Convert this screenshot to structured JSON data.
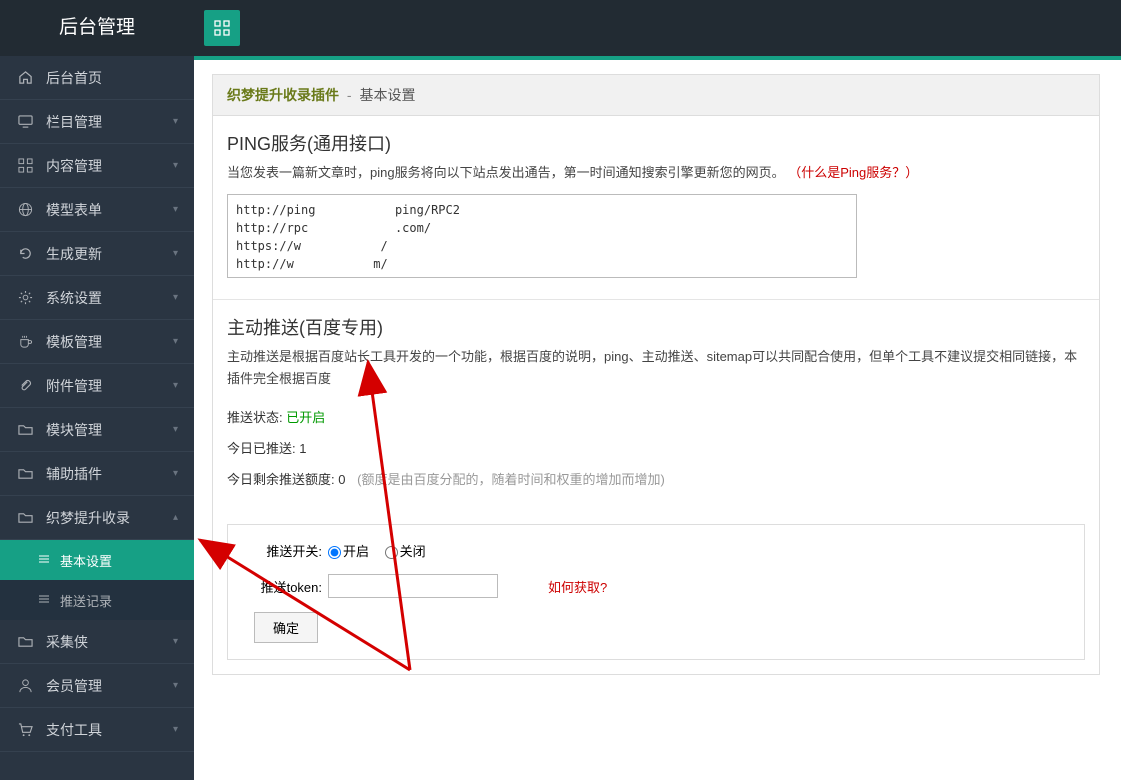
{
  "header": {
    "title": "后台管理"
  },
  "sidebar": {
    "items": [
      {
        "icon": "home",
        "label": "后台首页",
        "chev": ""
      },
      {
        "icon": "monitor",
        "label": "栏目管理",
        "chev": "▾"
      },
      {
        "icon": "grid",
        "label": "内容管理",
        "chev": "▾"
      },
      {
        "icon": "globe",
        "label": "模型表单",
        "chev": "▾"
      },
      {
        "icon": "refresh",
        "label": "生成更新",
        "chev": "▾"
      },
      {
        "icon": "gear",
        "label": "系统设置",
        "chev": "▾"
      },
      {
        "icon": "cup",
        "label": "模板管理",
        "chev": "▾"
      },
      {
        "icon": "clip",
        "label": "附件管理",
        "chev": "▾"
      },
      {
        "icon": "folder",
        "label": "模块管理",
        "chev": "▾"
      },
      {
        "icon": "folder",
        "label": "辅助插件",
        "chev": "▾"
      },
      {
        "icon": "folder",
        "label": "织梦提升收录",
        "chev": "▴",
        "expanded": true,
        "children": [
          {
            "label": "基本设置",
            "active": true
          },
          {
            "label": "推送记录",
            "active": false
          }
        ]
      },
      {
        "icon": "folder",
        "label": "采集侠",
        "chev": "▾"
      },
      {
        "icon": "user",
        "label": "会员管理",
        "chev": "▾"
      },
      {
        "icon": "cart",
        "label": "支付工具",
        "chev": "▾"
      }
    ]
  },
  "panel": {
    "plugin": "织梦提升收录插件",
    "sep": "-",
    "subtitle": "基本设置"
  },
  "ping": {
    "title": "PING服务(通用接口)",
    "desc": "当您发表一篇新文章时，ping服务将向以下站点发出通告，第一时间通知搜索引擎更新您的网页。",
    "link": "（什么是Ping服务？）",
    "urls": "http://ping           ping/RPC2\nhttp://rpc            .com/\nhttps://w           /\nhttp://w           m/"
  },
  "push": {
    "title": "主动推送(百度专用)",
    "desc": "主动推送是根据百度站长工具开发的一个功能，根据百度的说明，ping、主动推送、sitemap可以共同配合使用，但单个工具不建议提交相同链接，本插件完全根据百度",
    "status_label": "推送状态:",
    "status_value": "已开启",
    "today_label": "今日已推送:",
    "today_value": "1",
    "quota_label": "今日剩余推送额度:",
    "quota_value": "0",
    "quota_note": "(额度是由百度分配的，随着时间和权重的增加而增加)"
  },
  "form": {
    "switch_label": "推送开关:",
    "switch_on": "开启",
    "switch_off": "关闭",
    "token_label": "推送token:",
    "token_value": "",
    "how_link": "如何获取?",
    "submit": "确定"
  }
}
